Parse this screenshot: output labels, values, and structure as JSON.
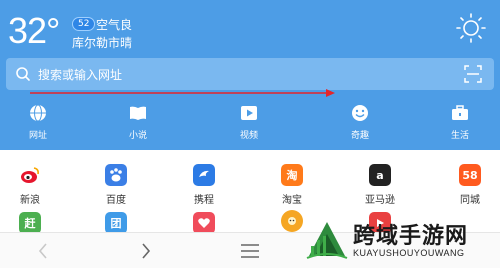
{
  "weather": {
    "temperature": "32°",
    "aqi_value": "52",
    "aqi_label": "空气良",
    "city": "库尔勒市",
    "condition": "晴"
  },
  "search": {
    "placeholder": "搜索或输入网址"
  },
  "nav": {
    "items": [
      {
        "label": "网址",
        "icon": "globe-icon"
      },
      {
        "label": "小说",
        "icon": "book-icon"
      },
      {
        "label": "视频",
        "icon": "play-icon"
      },
      {
        "label": "奇趣",
        "icon": "smile-icon"
      },
      {
        "label": "生活",
        "icon": "toolbox-icon"
      }
    ]
  },
  "apps": {
    "row1": [
      {
        "label": "新浪",
        "icon": "sina-icon",
        "color": "#ffffff"
      },
      {
        "label": "百度",
        "icon": "baidu-icon",
        "color": "#3b7fe6"
      },
      {
        "label": "携程",
        "icon": "ctrip-icon",
        "color": "#2c7be5"
      },
      {
        "label": "淘宝",
        "icon": "taobao-icon",
        "glyph": "淘",
        "color": "#ff7a1a"
      },
      {
        "label": "亚马逊",
        "icon": "amazon-icon",
        "glyph": "a",
        "color": "#222222"
      },
      {
        "label": "同城",
        "icon": "58-icon",
        "glyph": "58",
        "color": "#ff5a1f"
      }
    ],
    "row2": [
      {
        "icon": "ganji-icon",
        "glyph": "赶",
        "color": "#4caf50"
      },
      {
        "icon": "tuan-icon",
        "glyph": "团",
        "color": "#3f9be8"
      },
      {
        "icon": "heart-app-icon",
        "color": "#f04c5b"
      },
      {
        "icon": "lion-icon",
        "color": "#f5a623"
      },
      {
        "icon": "video-app-icon",
        "color": "#e94040"
      }
    ]
  },
  "watermark": {
    "title": "跨域手游网",
    "subtitle": "KUAYUSHOUYOUWANG"
  },
  "colors": {
    "header": "#4d9de6",
    "search_bar": "#7ab8f0",
    "arrow": "#e5252a"
  }
}
